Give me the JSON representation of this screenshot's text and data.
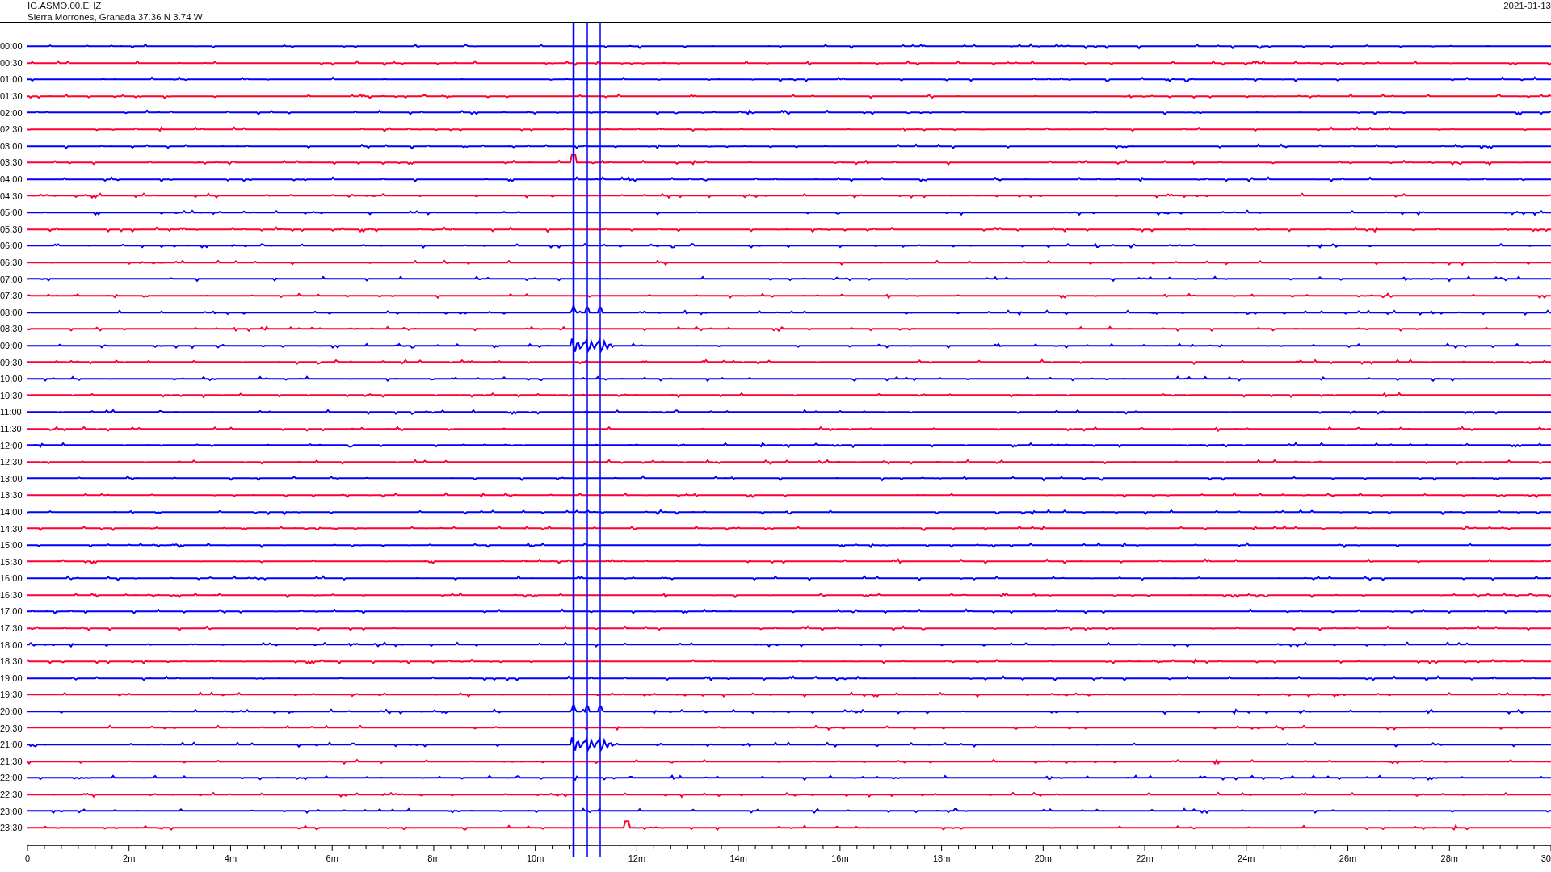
{
  "header": {
    "station": "IG.ASMO.00.EHZ",
    "location": "Sierra Morrones, Granada  37.36 N 3.74 W",
    "date": "2021-01-13"
  },
  "rows": [
    {
      "time": "00:00",
      "color": "#0000ff"
    },
    {
      "time": "00:30",
      "color": "#ff0033"
    },
    {
      "time": "01:00",
      "color": "#0000ff"
    },
    {
      "time": "01:30",
      "color": "#ff0033"
    },
    {
      "time": "02:00",
      "color": "#0000ff"
    },
    {
      "time": "02:30",
      "color": "#ff0033"
    },
    {
      "time": "03:00",
      "color": "#0000ff"
    },
    {
      "time": "03:30",
      "color": "#ff0033"
    },
    {
      "time": "04:00",
      "color": "#0000ff"
    },
    {
      "time": "04:30",
      "color": "#ff0033"
    },
    {
      "time": "05:00",
      "color": "#0000ff"
    },
    {
      "time": "05:30",
      "color": "#ff0033"
    },
    {
      "time": "06:00",
      "color": "#0000ff"
    },
    {
      "time": "06:30",
      "color": "#ff0033"
    },
    {
      "time": "07:00",
      "color": "#0000ff"
    },
    {
      "time": "07:30",
      "color": "#ff0033"
    },
    {
      "time": "08:00",
      "color": "#0000ff"
    },
    {
      "time": "08:30",
      "color": "#ff0033"
    },
    {
      "time": "09:00",
      "color": "#0000ff"
    },
    {
      "time": "09:30",
      "color": "#ff0033"
    },
    {
      "time": "10:00",
      "color": "#0000ff"
    },
    {
      "time": "10:30",
      "color": "#ff0033"
    },
    {
      "time": "11:00",
      "color": "#0000ff"
    },
    {
      "time": "11:30",
      "color": "#ff0033"
    },
    {
      "time": "12:00",
      "color": "#0000ff"
    },
    {
      "time": "12:30",
      "color": "#ff0033"
    },
    {
      "time": "13:00",
      "color": "#0000ff"
    },
    {
      "time": "13:30",
      "color": "#ff0033"
    },
    {
      "time": "14:00",
      "color": "#0000ff"
    },
    {
      "time": "14:30",
      "color": "#ff0033"
    },
    {
      "time": "15:00",
      "color": "#0000ff"
    },
    {
      "time": "15:30",
      "color": "#ff0033"
    },
    {
      "time": "16:00",
      "color": "#0000ff"
    },
    {
      "time": "16:30",
      "color": "#ff0033"
    },
    {
      "time": "17:00",
      "color": "#0000ff"
    },
    {
      "time": "17:30",
      "color": "#ff0033"
    },
    {
      "time": "18:00",
      "color": "#0000ff"
    },
    {
      "time": "18:30",
      "color": "#ff0033"
    },
    {
      "time": "19:00",
      "color": "#0000ff"
    },
    {
      "time": "19:30",
      "color": "#ff0033"
    },
    {
      "time": "20:00",
      "color": "#0000ff"
    },
    {
      "time": "20:30",
      "color": "#ff0033"
    },
    {
      "time": "21:00",
      "color": "#0000ff"
    },
    {
      "time": "21:30",
      "color": "#ff0033"
    },
    {
      "time": "22:00",
      "color": "#0000ff"
    },
    {
      "time": "22:30",
      "color": "#ff0033"
    },
    {
      "time": "23:00",
      "color": "#0000ff"
    },
    {
      "time": "23:30",
      "color": "#ff0033"
    }
  ],
  "x_axis": {
    "ticks": [
      "0",
      "2m",
      "4m",
      "6m",
      "8m",
      "10m",
      "12m",
      "14m",
      "16m",
      "18m",
      "20m",
      "22m",
      "24m",
      "26m",
      "28m",
      "30"
    ]
  }
}
